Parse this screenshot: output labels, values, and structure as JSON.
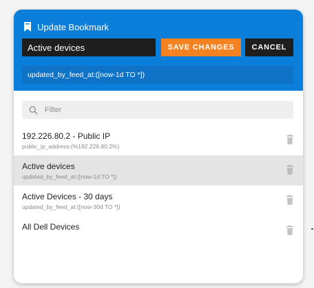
{
  "dialog": {
    "title": "Update Bookmark",
    "name_value": "Active devices",
    "save_label": "SAVE CHANGES",
    "cancel_label": "CANCEL",
    "query_value": "updated_by_feed_at:([now-1d TO *])"
  },
  "filter": {
    "placeholder": "Filter",
    "value": ""
  },
  "bookmarks": [
    {
      "title": "192.226.80.2 - Public IP",
      "query": "public_ip_address:(%192.226.80.2%)"
    },
    {
      "title": "Active devices",
      "query": "updated_by_feed_at:([now-1d TO *])"
    },
    {
      "title": "Active Devices - 30 days",
      "query": "updated_by_feed_at:([now-30d TO *])"
    },
    {
      "title": "All Dell Devices",
      "query": ""
    }
  ],
  "colors": {
    "header": "#0a7ed8",
    "save_button": "#f58220",
    "dark_field": "#1e1e1e",
    "selected_row": "#e4e4e4"
  },
  "icons": [
    "bookmark-icon",
    "search-icon",
    "trash-icon"
  ]
}
